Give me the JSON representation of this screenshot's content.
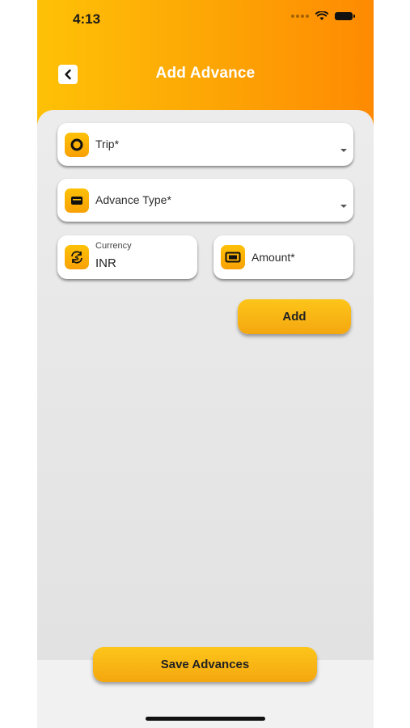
{
  "status_bar": {
    "time": "4:13"
  },
  "header": {
    "title": "Add Advance"
  },
  "form": {
    "trip_label": "Trip*",
    "advance_type_label": "Advance Type*",
    "currency_label": "Currency",
    "currency_value": "INR",
    "amount_label": "Amount*"
  },
  "buttons": {
    "add_label": "Add",
    "save_label": "Save Advances"
  },
  "colors": {
    "header_start": "#fec106",
    "header_end": "#fe8a02",
    "button": "#f8b512"
  },
  "icons": [
    "chevron-left-icon",
    "circle-icon",
    "wallet-icon",
    "currency-exchange-icon",
    "banknote-icon",
    "chevron-down-icon"
  ]
}
